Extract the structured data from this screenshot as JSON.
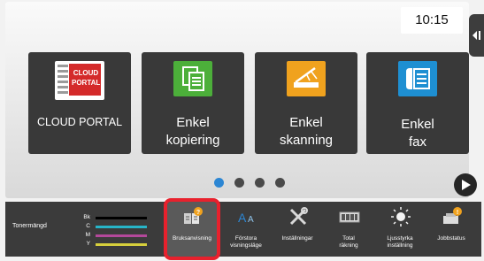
{
  "clock": "10:15",
  "tiles": [
    {
      "id": "cloud-portal",
      "label_lines": [
        "CLOUD PORTAL"
      ],
      "logo_text": [
        "CLOUD",
        "PORTAL"
      ]
    },
    {
      "id": "simple-copy",
      "label_lines": [
        "Enkel",
        "kopiering"
      ]
    },
    {
      "id": "simple-scan",
      "label_lines": [
        "Enkel",
        "skanning"
      ]
    },
    {
      "id": "simple-fax",
      "label_lines": [
        "Enkel",
        "fax"
      ]
    }
  ],
  "pagination": {
    "pages": 4,
    "current": 1
  },
  "toner": {
    "title": "Tonermängd",
    "colors": [
      {
        "label": "Bk",
        "color": "#000000"
      },
      {
        "label": "C",
        "color": "#27b5c9"
      },
      {
        "label": "M",
        "color": "#b3489a"
      },
      {
        "label": "Y",
        "color": "#d6cf3c"
      }
    ]
  },
  "functions": [
    {
      "id": "manual",
      "label_lines": [
        "Bruksanvisning"
      ],
      "icon": "book-question-icon",
      "selected": true
    },
    {
      "id": "enlarge",
      "label_lines": [
        "Förstora",
        "visningsläge"
      ],
      "icon": "enlarge-text-icon"
    },
    {
      "id": "settings",
      "label_lines": [
        "Inställningar"
      ],
      "icon": "tools-icon"
    },
    {
      "id": "total-count",
      "label_lines": [
        "Total",
        "räkning"
      ],
      "icon": "counter-icon"
    },
    {
      "id": "brightness",
      "label_lines": [
        "Ljusstyrka",
        "inställning"
      ],
      "icon": "brightness-icon"
    },
    {
      "id": "job-status",
      "label_lines": [
        "Jobbstatus"
      ],
      "icon": "job-status-icon"
    }
  ],
  "colors": {
    "accent_blue": "#2c86d3",
    "selection_red": "#e8212d",
    "tile_bg": "#393939",
    "bar_bg": "#3b3b3b"
  }
}
